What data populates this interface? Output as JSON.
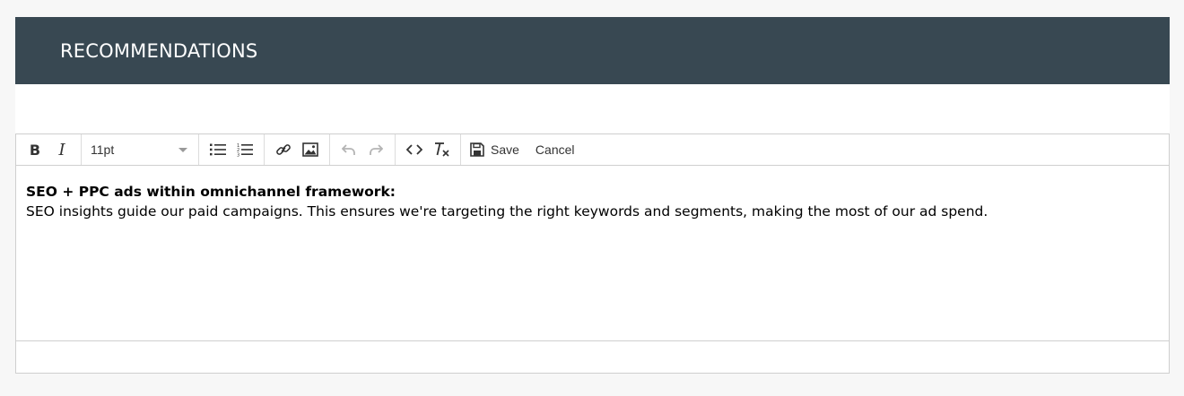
{
  "panel": {
    "title": "RECOMMENDATIONS"
  },
  "toolbar": {
    "bold_icon": "bold-icon",
    "italic_icon": "italic-icon",
    "font_size": "11pt",
    "bullet_list_icon": "bulleted-list-icon",
    "numbered_list_icon": "numbered-list-icon",
    "link_icon": "link-icon",
    "image_icon": "image-icon",
    "undo_icon": "undo-icon",
    "redo_icon": "redo-icon",
    "code_icon": "code-icon",
    "clear_format_icon": "clear-formatting-icon",
    "save_icon": "floppy-disk-icon",
    "save_label": "Save",
    "cancel_label": "Cancel"
  },
  "content": {
    "heading": "SEO + PPC ads within omnichannel framework:",
    "body": "SEO insights guide our paid campaigns. This ensures we're targeting the right keywords and segments, making the most of our ad spend."
  },
  "colors": {
    "header_bg": "#384852",
    "header_text": "#ffffff",
    "border": "#cfcfcf",
    "disabled_icon": "#b4b4b4"
  }
}
